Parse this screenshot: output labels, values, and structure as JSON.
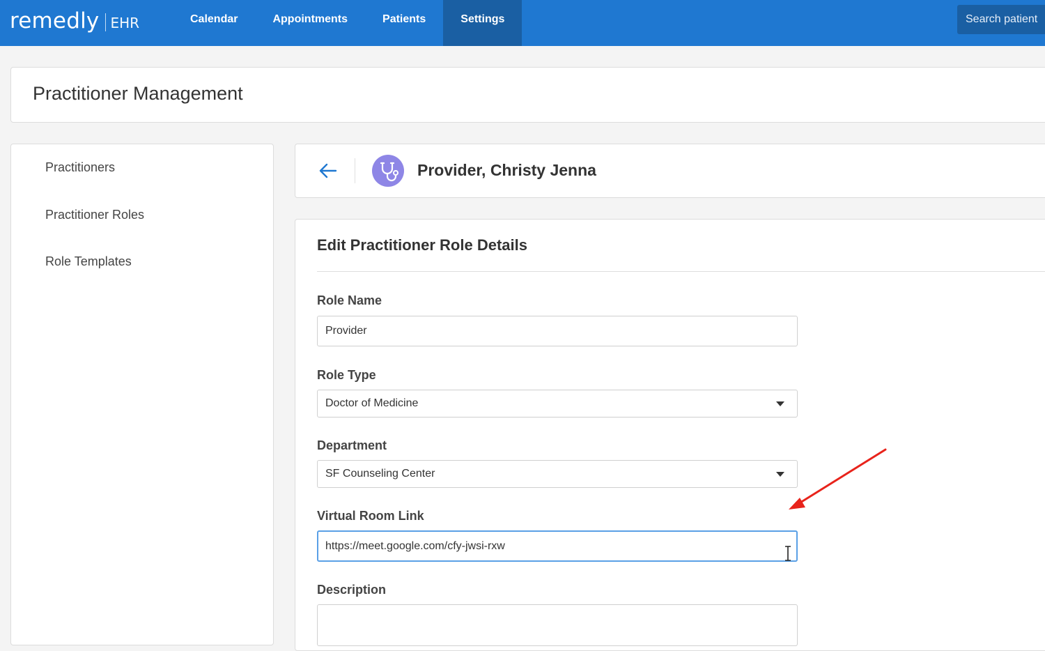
{
  "brand": {
    "name": "remedly",
    "product": "EHR"
  },
  "nav": {
    "items": [
      {
        "label": "Calendar",
        "active": false
      },
      {
        "label": "Appointments",
        "active": false
      },
      {
        "label": "Patients",
        "active": false
      },
      {
        "label": "Settings",
        "active": true
      }
    ]
  },
  "search": {
    "placeholder": "Search patient"
  },
  "page": {
    "title": "Practitioner Management"
  },
  "sidebar": {
    "items": [
      {
        "label": "Practitioners"
      },
      {
        "label": "Practitioner Roles"
      },
      {
        "label": "Role Templates"
      }
    ]
  },
  "practitioner": {
    "name": "Provider, Christy Jenna",
    "avatar_icon": "stethoscope-icon",
    "avatar_color": "#8e86e6"
  },
  "form": {
    "title": "Edit Practitioner Role Details",
    "role_name": {
      "label": "Role Name",
      "value": "Provider"
    },
    "role_type": {
      "label": "Role Type",
      "value": "Doctor of Medicine"
    },
    "department": {
      "label": "Department",
      "value": "SF Counseling Center"
    },
    "virtual_room_link": {
      "label": "Virtual Room Link",
      "value": "https://meet.google.com/cfy-jwsi-rxw"
    },
    "description": {
      "label": "Description",
      "value": ""
    }
  },
  "colors": {
    "topbar": "#1f78d1",
    "topbar_active": "#1a5fa3",
    "focus_border": "#5aa0e6",
    "annotation_arrow": "#e8231b"
  }
}
